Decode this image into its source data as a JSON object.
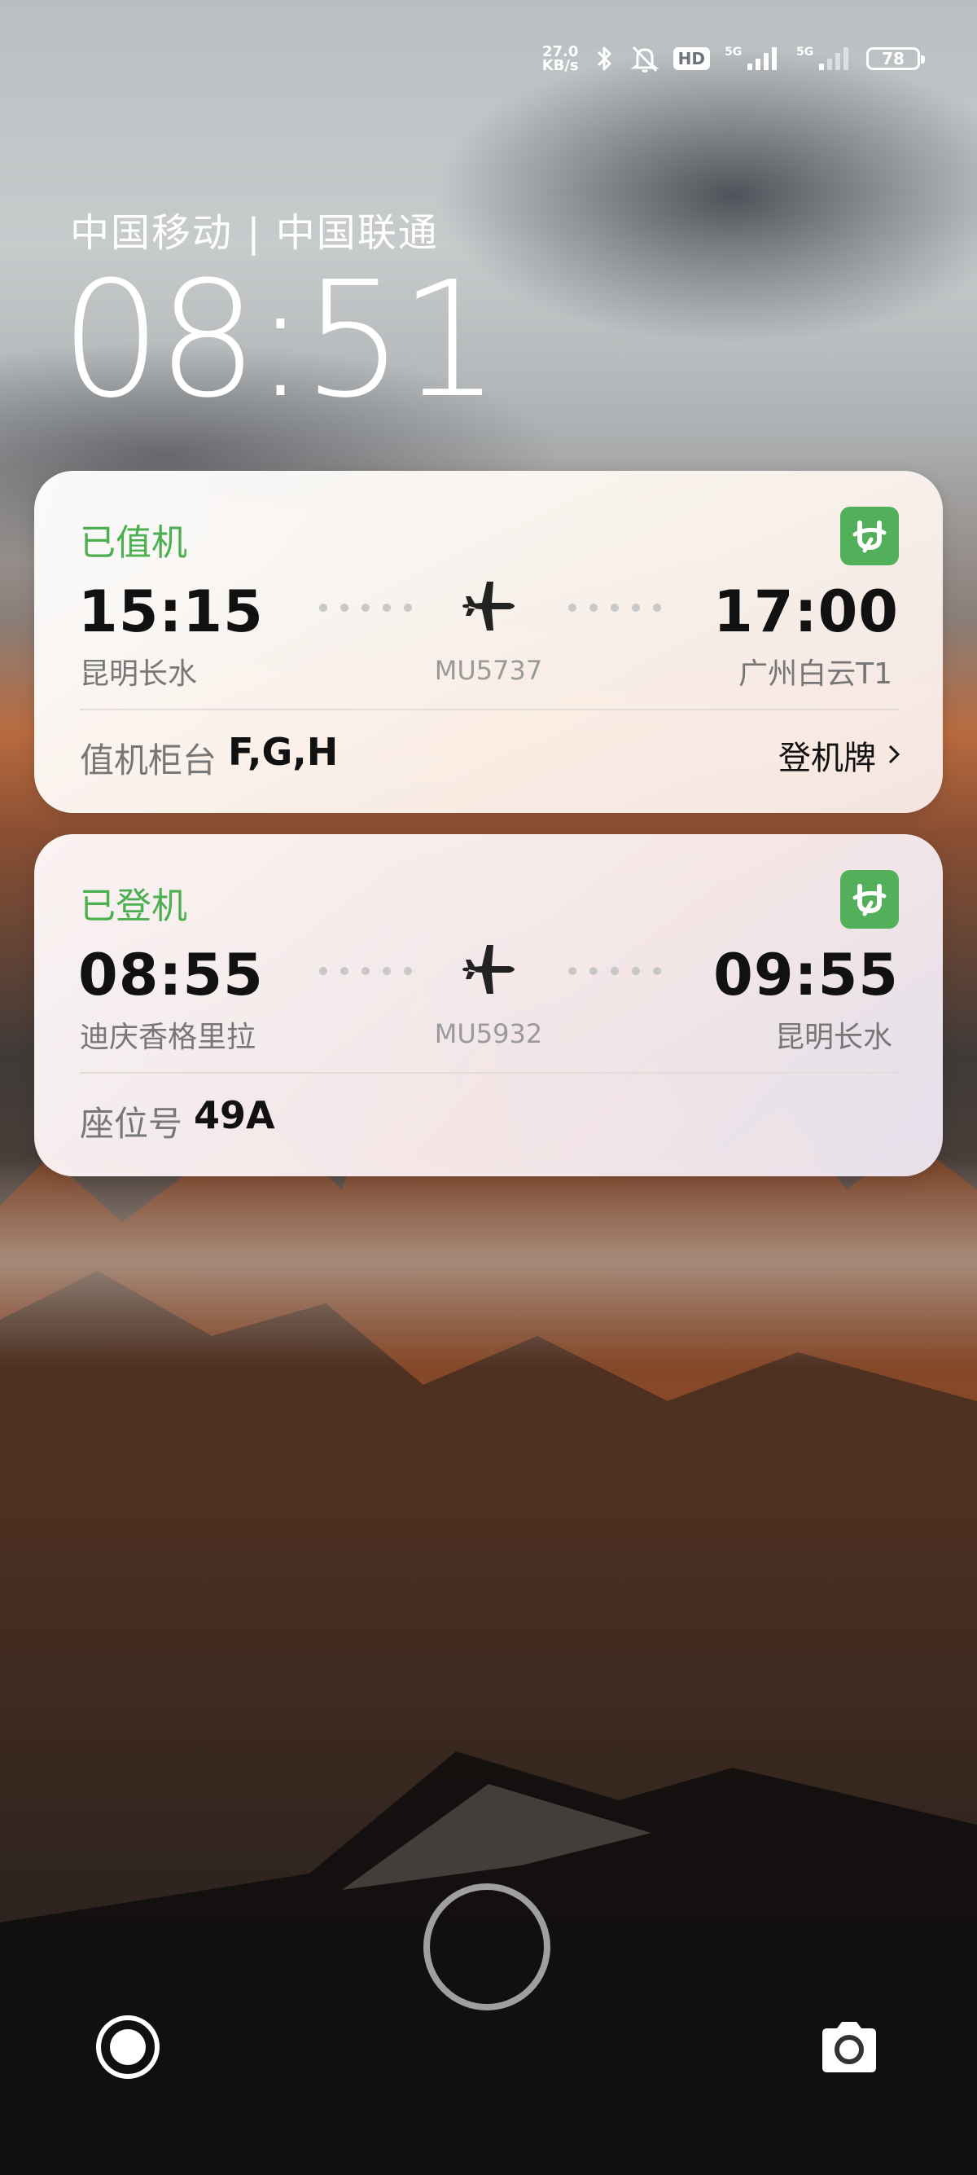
{
  "status_bar": {
    "net_speed_top": "27.0",
    "net_speed_bottom": "KB/s",
    "hd_label": "HD",
    "signal1_label": "5G",
    "signal2_label": "5G",
    "battery_level": "78"
  },
  "lockscreen": {
    "carrier": "中国移动 | 中国联通",
    "time": "08:51"
  },
  "cards": [
    {
      "status": "已值机",
      "dep_time": "15:15",
      "dep_city": "昆明长水",
      "flight_no": "MU5737",
      "arr_time": "17:00",
      "arr_city": "广州白云T1",
      "info_label": "值机柜台",
      "info_value": "F,G,H",
      "link": "登机牌"
    },
    {
      "status": "已登机",
      "dep_time": "08:55",
      "dep_city": "迪庆香格里拉",
      "flight_no": "MU5932",
      "arr_time": "09:55",
      "arr_city": "昆明长水",
      "info_label": "座位号",
      "info_value": "49A"
    }
  ],
  "colors": {
    "status_green": "#4caf50",
    "logo_green": "#53b05a"
  },
  "icons": {
    "status": [
      "bluetooth-icon",
      "mute-icon",
      "hd-icon",
      "signal-5g-icon",
      "battery-icon"
    ],
    "card": [
      "airline-logo-icon",
      "plane-icon",
      "chevron-right-icon"
    ],
    "bottom": [
      "fingerprint-ring-icon",
      "shortcut-icon",
      "camera-icon"
    ]
  }
}
